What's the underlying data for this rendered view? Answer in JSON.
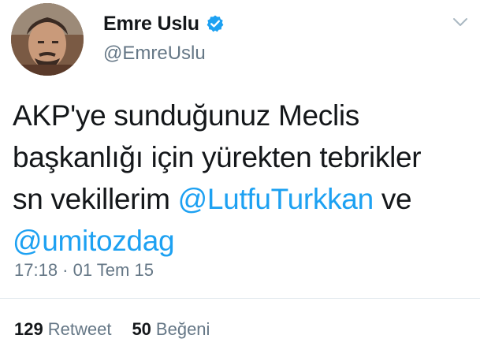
{
  "tweet": {
    "display_name": "Emre Uslu",
    "handle": "@EmreUslu",
    "text_lines": [
      "AKP'ye sunduğunuz Meclis",
      "başkanlığı için yürekten tebrikler",
      "sn vekillerim "
    ],
    "mention_1": "@LutfuTurkkan",
    "after_mention_1": " ve",
    "mention_2": "@umitozdag",
    "timestamp": "17:18 · 01 Tem 15"
  },
  "stats": {
    "retweet_count": "129",
    "retweet_label": "Retweet",
    "like_count": "50",
    "like_label": "Beğeni"
  },
  "icons": {
    "verified": "verified-badge-icon",
    "caret": "chevron-down-icon"
  },
  "colors": {
    "accent": "#1da1f2",
    "secondary_text": "#657786",
    "primary_text": "#14171a",
    "divider": "#e1e8ed"
  }
}
